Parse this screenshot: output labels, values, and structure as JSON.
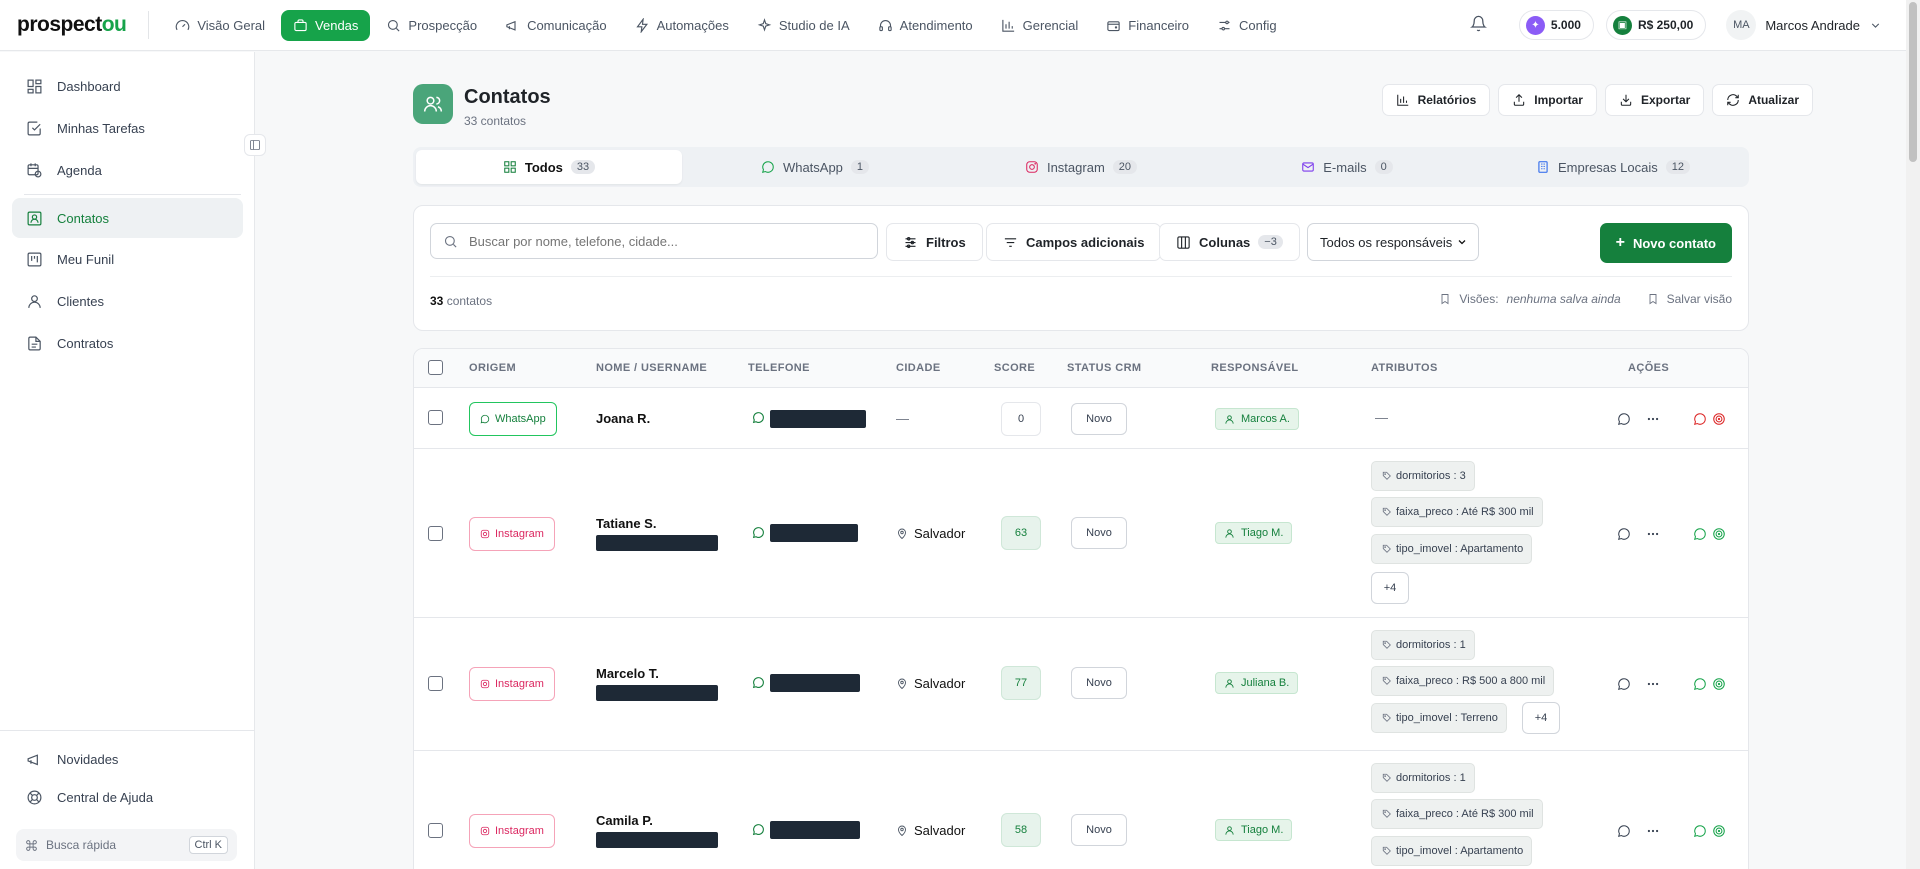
{
  "brand": {
    "prefix": "prospect",
    "suffix": "ou"
  },
  "nav": [
    {
      "label": "Visão Geral",
      "icon": "gauge-icon"
    },
    {
      "label": "Vendas",
      "icon": "briefcase-icon",
      "active": true
    },
    {
      "label": "Prospecção",
      "icon": "search-icon"
    },
    {
      "label": "Comunicação",
      "icon": "megaphone-icon"
    },
    {
      "label": "Automações",
      "icon": "zap-icon"
    },
    {
      "label": "Studio de IA",
      "icon": "sparkles-icon"
    },
    {
      "label": "Atendimento",
      "icon": "headset-icon"
    },
    {
      "label": "Gerencial",
      "icon": "bar-chart-icon"
    },
    {
      "label": "Financeiro",
      "icon": "wallet-icon"
    },
    {
      "label": "Config",
      "icon": "sliders-icon"
    }
  ],
  "top": {
    "credits": "5.000",
    "balance": "R$ 250,00",
    "user_initials": "MA",
    "user_name": "Marcos Andrade"
  },
  "sidebar": {
    "items": [
      {
        "label": "Dashboard",
        "icon": "grid-icon"
      },
      {
        "label": "Minhas Tarefas",
        "icon": "check-square-icon"
      },
      {
        "label": "Agenda",
        "icon": "calendar-clock-icon"
      },
      {
        "label": "Contatos",
        "icon": "contact-icon",
        "active": true
      },
      {
        "label": "Meu Funil",
        "icon": "kanban-icon"
      },
      {
        "label": "Clientes",
        "icon": "user-icon"
      },
      {
        "label": "Contratos",
        "icon": "file-text-icon"
      }
    ],
    "bottom": [
      {
        "label": "Novidades",
        "icon": "megaphone-icon"
      },
      {
        "label": "Central de Ajuda",
        "icon": "life-buoy-icon"
      }
    ],
    "quick_search": "Busca rápida",
    "quick_shortcut": "Ctrl K"
  },
  "page": {
    "title": "Contatos",
    "subtitle": "33 contatos",
    "actions": [
      "Relatórios",
      "Importar",
      "Exportar",
      "Atualizar"
    ]
  },
  "tabs": [
    {
      "label": "Todos",
      "count": "33",
      "icon": "grid-icon",
      "color": "#15803d"
    },
    {
      "label": "WhatsApp",
      "count": "1",
      "icon": "message-circle-icon",
      "color": "#16a34a"
    },
    {
      "label": "Instagram",
      "count": "20",
      "icon": "instagram-icon",
      "color": "#db2760"
    },
    {
      "label": "E-mails",
      "count": "0",
      "icon": "mail-icon",
      "color": "#7c3aed"
    },
    {
      "label": "Empresas Locais",
      "count": "12",
      "icon": "building-icon",
      "color": "#2563eb"
    }
  ],
  "filters": {
    "search_placeholder": "Buscar por nome, telefone, cidade...",
    "filters_label": "Filtros",
    "fields_label": "Campos adicionais",
    "columns_label": "Colunas",
    "columns_badge": "−3",
    "responsible_select": "Todos os responsáveis",
    "new_contact": "Novo contato",
    "count_number": "33",
    "count_label": "contatos",
    "views_label": "Visões:",
    "views_empty": "nenhuma salva ainda",
    "save_view": "Salvar visão"
  },
  "table": {
    "headers": [
      "ORIGEM",
      "NOME / USERNAME",
      "TELEFONE",
      "CIDADE",
      "SCORE",
      "STATUS CRM",
      "RESPONSÁVEL",
      "ATRIBUTOS",
      "AÇÕES"
    ],
    "rows": [
      {
        "origin": "WhatsApp",
        "name": "Joana R.",
        "city": "—",
        "score": "0",
        "status": "Novo",
        "responsible": "Marcos A.",
        "attributes": [],
        "attr_empty": "—"
      },
      {
        "origin": "Instagram",
        "name": "Tatiane S.",
        "city": "Salvador",
        "score": "63",
        "status": "Novo",
        "responsible": "Tiago M.",
        "attributes": [
          "dormitorios : 3",
          "faixa_preco : Até R$ 300 mil",
          "tipo_imovel : Apartamento"
        ],
        "more": "+4"
      },
      {
        "origin": "Instagram",
        "name": "Marcelo T.",
        "city": "Salvador",
        "score": "77",
        "status": "Novo",
        "responsible": "Juliana B.",
        "attributes": [
          "dormitorios : 1",
          "faixa_preco : R$ 500 a 800 mil",
          "tipo_imovel : Terreno"
        ],
        "more": "+4"
      },
      {
        "origin": "Instagram",
        "name": "Camila P.",
        "city": "Salvador",
        "score": "58",
        "status": "Novo",
        "responsible": "Tiago M.",
        "attributes": [
          "dormitorios : 1",
          "faixa_preco : Até R$ 300 mil",
          "tipo_imovel : Apartamento"
        ]
      }
    ]
  }
}
